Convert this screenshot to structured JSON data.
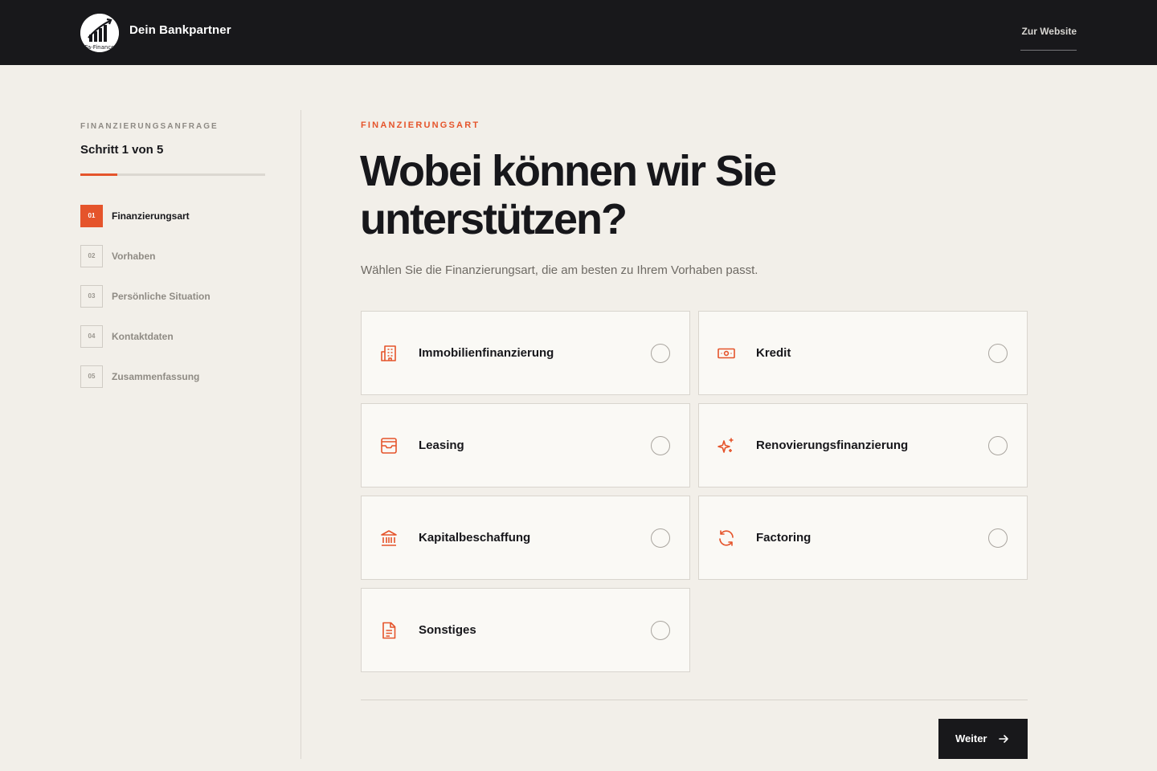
{
  "header": {
    "logo_text": "Fa-Finance",
    "brand": "Dein Bankpartner",
    "website_link": "Zur Website"
  },
  "sidebar": {
    "caption": "FINANZIERUNGSANFRAGE",
    "step_counter": "Schritt 1 von 5",
    "progress_fraction": 0.2,
    "steps": [
      {
        "num": "01",
        "label": "Finanzierungsart",
        "active": true
      },
      {
        "num": "02",
        "label": "Vorhaben",
        "active": false
      },
      {
        "num": "03",
        "label": "Persönliche Situation",
        "active": false
      },
      {
        "num": "04",
        "label": "Kontaktdaten",
        "active": false
      },
      {
        "num": "05",
        "label": "Zusammenfassung",
        "active": false
      }
    ]
  },
  "main": {
    "eyebrow": "FINANZIERUNGSART",
    "headline_line1": "Wobei können wir Sie",
    "headline_line2": "unterstützen?",
    "subtitle": "Wählen Sie die Finanzierungsart, die am besten zu Ihrem Vorhaben passt.",
    "options": [
      {
        "label": "Immobilienfinanzierung",
        "icon": "building-icon"
      },
      {
        "label": "Kredit",
        "icon": "banknote-icon"
      },
      {
        "label": "Leasing",
        "icon": "inbox-icon"
      },
      {
        "label": "Renovierungsfinanzierung",
        "icon": "sparkles-icon"
      },
      {
        "label": "Kapitalbeschaffung",
        "icon": "bank-icon"
      },
      {
        "label": "Factoring",
        "icon": "refresh-icon"
      },
      {
        "label": "Sonstiges",
        "icon": "document-icon"
      }
    ],
    "next_button": "Weiter"
  },
  "colors": {
    "accent": "#e5542b",
    "dark": "#18181b",
    "background": "#f2efe9",
    "card": "#faf9f5"
  }
}
